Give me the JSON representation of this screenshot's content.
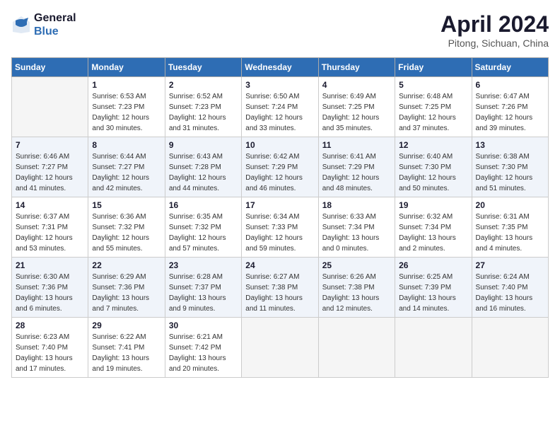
{
  "header": {
    "logo_general": "General",
    "logo_blue": "Blue",
    "title": "April 2024",
    "location": "Pitong, Sichuan, China"
  },
  "days_of_week": [
    "Sunday",
    "Monday",
    "Tuesday",
    "Wednesday",
    "Thursday",
    "Friday",
    "Saturday"
  ],
  "weeks": [
    [
      {
        "day": "",
        "info": ""
      },
      {
        "day": "1",
        "info": "Sunrise: 6:53 AM\nSunset: 7:23 PM\nDaylight: 12 hours\nand 30 minutes."
      },
      {
        "day": "2",
        "info": "Sunrise: 6:52 AM\nSunset: 7:23 PM\nDaylight: 12 hours\nand 31 minutes."
      },
      {
        "day": "3",
        "info": "Sunrise: 6:50 AM\nSunset: 7:24 PM\nDaylight: 12 hours\nand 33 minutes."
      },
      {
        "day": "4",
        "info": "Sunrise: 6:49 AM\nSunset: 7:25 PM\nDaylight: 12 hours\nand 35 minutes."
      },
      {
        "day": "5",
        "info": "Sunrise: 6:48 AM\nSunset: 7:25 PM\nDaylight: 12 hours\nand 37 minutes."
      },
      {
        "day": "6",
        "info": "Sunrise: 6:47 AM\nSunset: 7:26 PM\nDaylight: 12 hours\nand 39 minutes."
      }
    ],
    [
      {
        "day": "7",
        "info": "Sunrise: 6:46 AM\nSunset: 7:27 PM\nDaylight: 12 hours\nand 41 minutes."
      },
      {
        "day": "8",
        "info": "Sunrise: 6:44 AM\nSunset: 7:27 PM\nDaylight: 12 hours\nand 42 minutes."
      },
      {
        "day": "9",
        "info": "Sunrise: 6:43 AM\nSunset: 7:28 PM\nDaylight: 12 hours\nand 44 minutes."
      },
      {
        "day": "10",
        "info": "Sunrise: 6:42 AM\nSunset: 7:29 PM\nDaylight: 12 hours\nand 46 minutes."
      },
      {
        "day": "11",
        "info": "Sunrise: 6:41 AM\nSunset: 7:29 PM\nDaylight: 12 hours\nand 48 minutes."
      },
      {
        "day": "12",
        "info": "Sunrise: 6:40 AM\nSunset: 7:30 PM\nDaylight: 12 hours\nand 50 minutes."
      },
      {
        "day": "13",
        "info": "Sunrise: 6:38 AM\nSunset: 7:30 PM\nDaylight: 12 hours\nand 51 minutes."
      }
    ],
    [
      {
        "day": "14",
        "info": "Sunrise: 6:37 AM\nSunset: 7:31 PM\nDaylight: 12 hours\nand 53 minutes."
      },
      {
        "day": "15",
        "info": "Sunrise: 6:36 AM\nSunset: 7:32 PM\nDaylight: 12 hours\nand 55 minutes."
      },
      {
        "day": "16",
        "info": "Sunrise: 6:35 AM\nSunset: 7:32 PM\nDaylight: 12 hours\nand 57 minutes."
      },
      {
        "day": "17",
        "info": "Sunrise: 6:34 AM\nSunset: 7:33 PM\nDaylight: 12 hours\nand 59 minutes."
      },
      {
        "day": "18",
        "info": "Sunrise: 6:33 AM\nSunset: 7:34 PM\nDaylight: 13 hours\nand 0 minutes."
      },
      {
        "day": "19",
        "info": "Sunrise: 6:32 AM\nSunset: 7:34 PM\nDaylight: 13 hours\nand 2 minutes."
      },
      {
        "day": "20",
        "info": "Sunrise: 6:31 AM\nSunset: 7:35 PM\nDaylight: 13 hours\nand 4 minutes."
      }
    ],
    [
      {
        "day": "21",
        "info": "Sunrise: 6:30 AM\nSunset: 7:36 PM\nDaylight: 13 hours\nand 6 minutes."
      },
      {
        "day": "22",
        "info": "Sunrise: 6:29 AM\nSunset: 7:36 PM\nDaylight: 13 hours\nand 7 minutes."
      },
      {
        "day": "23",
        "info": "Sunrise: 6:28 AM\nSunset: 7:37 PM\nDaylight: 13 hours\nand 9 minutes."
      },
      {
        "day": "24",
        "info": "Sunrise: 6:27 AM\nSunset: 7:38 PM\nDaylight: 13 hours\nand 11 minutes."
      },
      {
        "day": "25",
        "info": "Sunrise: 6:26 AM\nSunset: 7:38 PM\nDaylight: 13 hours\nand 12 minutes."
      },
      {
        "day": "26",
        "info": "Sunrise: 6:25 AM\nSunset: 7:39 PM\nDaylight: 13 hours\nand 14 minutes."
      },
      {
        "day": "27",
        "info": "Sunrise: 6:24 AM\nSunset: 7:40 PM\nDaylight: 13 hours\nand 16 minutes."
      }
    ],
    [
      {
        "day": "28",
        "info": "Sunrise: 6:23 AM\nSunset: 7:40 PM\nDaylight: 13 hours\nand 17 minutes."
      },
      {
        "day": "29",
        "info": "Sunrise: 6:22 AM\nSunset: 7:41 PM\nDaylight: 13 hours\nand 19 minutes."
      },
      {
        "day": "30",
        "info": "Sunrise: 6:21 AM\nSunset: 7:42 PM\nDaylight: 13 hours\nand 20 minutes."
      },
      {
        "day": "",
        "info": ""
      },
      {
        "day": "",
        "info": ""
      },
      {
        "day": "",
        "info": ""
      },
      {
        "day": "",
        "info": ""
      }
    ]
  ]
}
